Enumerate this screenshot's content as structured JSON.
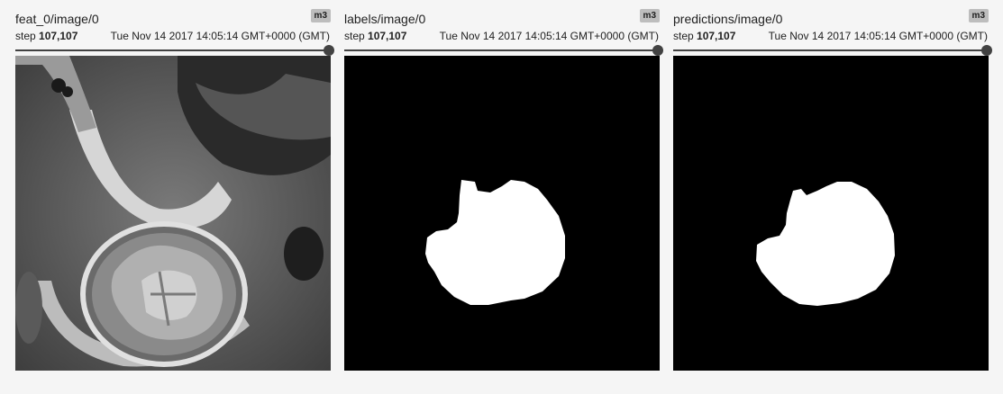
{
  "cards": [
    {
      "title": "feat_0/image/0",
      "run": "m3",
      "step_label": "step",
      "step_value": "107,107",
      "timestamp": "Tue Nov 14 2017 14:05:14 GMT+0000 (GMT)",
      "image_kind": "mri-grayscale"
    },
    {
      "title": "labels/image/0",
      "run": "m3",
      "step_label": "step",
      "step_value": "107,107",
      "timestamp": "Tue Nov 14 2017 14:05:14 GMT+0000 (GMT)",
      "image_kind": "segmentation-mask"
    },
    {
      "title": "predictions/image/0",
      "run": "m3",
      "step_label": "step",
      "step_value": "107,107",
      "timestamp": "Tue Nov 14 2017 14:05:14 GMT+0000 (GMT)",
      "image_kind": "segmentation-mask"
    }
  ],
  "slider_position": 1.0,
  "colors": {
    "background": "#f5f5f5",
    "badge": "#bdbdbd",
    "slider": "#424242",
    "mask_fg": "#ffffff",
    "mask_bg": "#000000"
  }
}
